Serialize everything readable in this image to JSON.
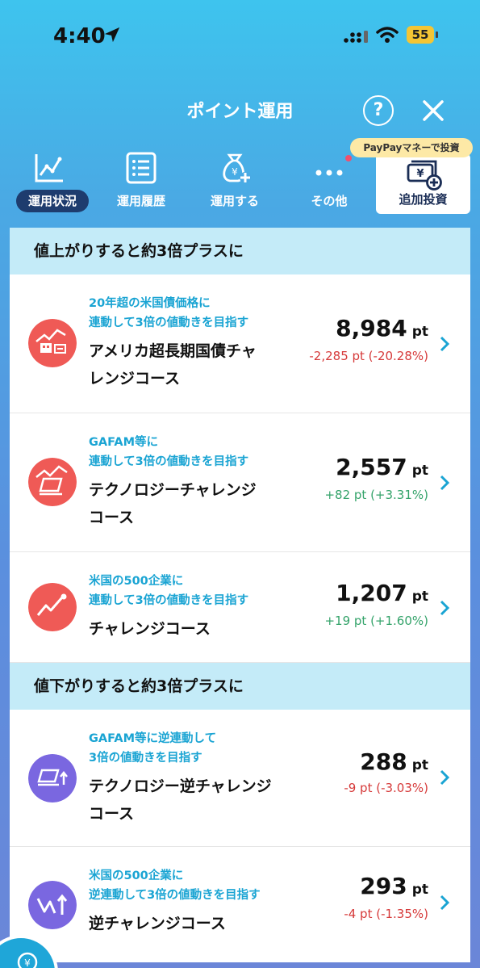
{
  "status_bar": {
    "time": "4:40",
    "battery": "55"
  },
  "header": {
    "title": "ポイント運用",
    "help_label": "?"
  },
  "tabs": [
    {
      "label": "運用状況"
    },
    {
      "label": "運用履歴"
    },
    {
      "label": "運用する"
    },
    {
      "label": "その他"
    }
  ],
  "extra_tab": {
    "label": "追加投資",
    "badge": "PayPayマネーで投資"
  },
  "sections": [
    {
      "title": "値上がりすると約3倍プラスに",
      "items": [
        {
          "desc1": "20年超の米国債価格に",
          "desc2": "連動して3倍の値動きを目指す",
          "name1": "アメリカ超長期国債チャ",
          "name2": "レンジコース",
          "points": "8,984",
          "unit": "pt",
          "change": "-2,285 pt (-20.28%)",
          "direction": "neg"
        },
        {
          "desc1": "GAFAM等に",
          "desc2": "連動して3倍の値動きを目指す",
          "name1": "テクノロジーチャレンジ",
          "name2": "コース",
          "points": "2,557",
          "unit": "pt",
          "change": "+82 pt (+3.31%)",
          "direction": "pos"
        },
        {
          "desc1": "米国の500企業に",
          "desc2": "連動して3倍の値動きを目指す",
          "name1": "チャレンジコース",
          "name2": "",
          "points": "1,207",
          "unit": "pt",
          "change": "+19 pt (+1.60%)",
          "direction": "pos"
        }
      ]
    },
    {
      "title": "値下がりすると約3倍プラスに",
      "items": [
        {
          "desc1": "GAFAM等に逆連動して",
          "desc2": "3倍の値動きを目指す",
          "name1": "テクノロジー逆チャレンジ",
          "name2": "コース",
          "points": "288",
          "unit": "pt",
          "change": "-9 pt (-3.03%)",
          "direction": "neg"
        },
        {
          "desc1": "米国の500企業に",
          "desc2": "逆連動して3倍の値動きを目指す",
          "name1": "逆チャレンジコース",
          "name2": "",
          "points": "293",
          "unit": "pt",
          "change": "-4 pt (-1.35%)",
          "direction": "neg"
        }
      ]
    }
  ],
  "colors": {
    "rise_icon": "#ef5a56",
    "fall_icon": "#7a67e0",
    "accent_text": "#1aa4d3",
    "negative": "#d63a3a",
    "positive": "#34a36a"
  }
}
